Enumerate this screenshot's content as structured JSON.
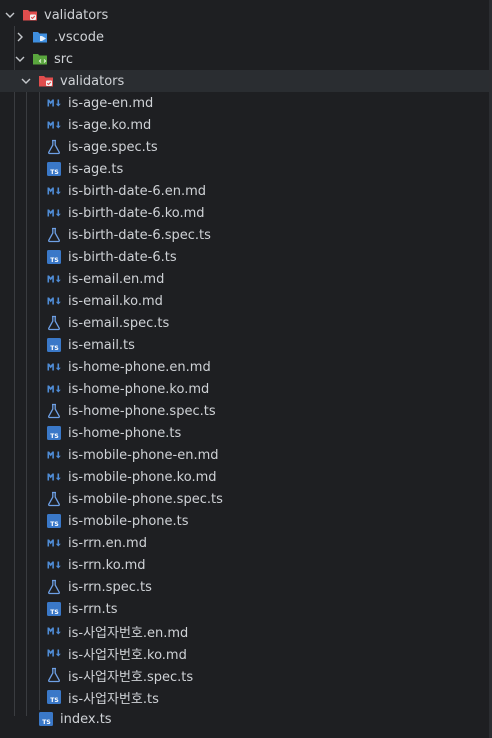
{
  "explorer": {
    "root": {
      "label": "validators",
      "icon": "folder-validators-icon"
    },
    "vscode": {
      "label": ".vscode",
      "icon": "folder-vscode-icon"
    },
    "src": {
      "label": "src",
      "icon": "folder-src-icon"
    },
    "src_validators": {
      "label": "validators",
      "icon": "folder-validators-icon"
    },
    "files": [
      {
        "label": "is-age-en.md",
        "type": "md"
      },
      {
        "label": "is-age.ko.md",
        "type": "md"
      },
      {
        "label": "is-age.spec.ts",
        "type": "spec"
      },
      {
        "label": "is-age.ts",
        "type": "ts"
      },
      {
        "label": "is-birth-date-6.en.md",
        "type": "md"
      },
      {
        "label": "is-birth-date-6.ko.md",
        "type": "md"
      },
      {
        "label": "is-birth-date-6.spec.ts",
        "type": "spec"
      },
      {
        "label": "is-birth-date-6.ts",
        "type": "ts"
      },
      {
        "label": "is-email.en.md",
        "type": "md"
      },
      {
        "label": "is-email.ko.md",
        "type": "md"
      },
      {
        "label": "is-email.spec.ts",
        "type": "spec"
      },
      {
        "label": "is-email.ts",
        "type": "ts"
      },
      {
        "label": "is-home-phone.en.md",
        "type": "md"
      },
      {
        "label": "is-home-phone.ko.md",
        "type": "md"
      },
      {
        "label": "is-home-phone.spec.ts",
        "type": "spec"
      },
      {
        "label": "is-home-phone.ts",
        "type": "ts"
      },
      {
        "label": "is-mobile-phone-en.md",
        "type": "md"
      },
      {
        "label": "is-mobile-phone.ko.md",
        "type": "md"
      },
      {
        "label": "is-mobile-phone.spec.ts",
        "type": "spec"
      },
      {
        "label": "is-mobile-phone.ts",
        "type": "ts"
      },
      {
        "label": "is-rrn.en.md",
        "type": "md"
      },
      {
        "label": "is-rrn.ko.md",
        "type": "md"
      },
      {
        "label": "is-rrn.spec.ts",
        "type": "spec"
      },
      {
        "label": "is-rrn.ts",
        "type": "ts"
      },
      {
        "label": "is-사업자번호.en.md",
        "type": "md"
      },
      {
        "label": "is-사업자번호.ko.md",
        "type": "md"
      },
      {
        "label": "is-사업자번호.spec.ts",
        "type": "spec"
      },
      {
        "label": "is-사업자번호.ts",
        "type": "ts"
      }
    ],
    "index": {
      "label": "index.ts",
      "type": "ts"
    },
    "colors": {
      "background": "#1e1f22",
      "selected": "#2a2d31",
      "text": "#cfd2d6",
      "md_icon": "#4f8cd6",
      "ts_icon": "#3a78c8",
      "spec_icon": "#6ea0e6",
      "folder_validators": "#e04d4d",
      "folder_vscode": "#3f8fe0",
      "folder_src": "#5aa63e"
    }
  }
}
